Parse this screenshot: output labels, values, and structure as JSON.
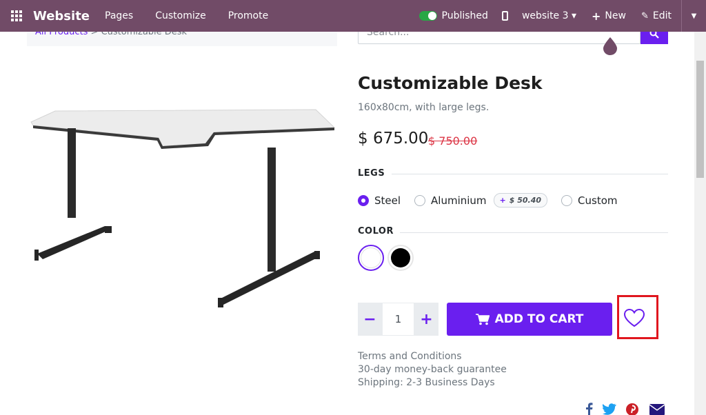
{
  "topbar": {
    "brand": "Website",
    "menus": [
      "Pages",
      "Customize",
      "Promote"
    ],
    "published_label": "Published",
    "website_selector": "website 3",
    "new_label": "New",
    "edit_label": "Edit"
  },
  "breadcrumb": {
    "parent": "All Products",
    "separator": ">",
    "current": "Customizable Desk"
  },
  "search": {
    "placeholder": "Search..."
  },
  "product": {
    "name": "Customizable Desk",
    "description": "160x80cm, with large legs.",
    "price": "$ 675.00",
    "old_price": "$ 750.00"
  },
  "attributes": {
    "legs": {
      "label": "LEGS",
      "options": [
        "Steel",
        "Aluminium",
        "Custom"
      ],
      "selected": "Steel",
      "aluminium_extra_sign": "+",
      "aluminium_extra": "$ 50.40"
    },
    "color": {
      "label": "COLOR",
      "swatches": [
        "#ffffff",
        "#000000"
      ],
      "selected": "#ffffff"
    }
  },
  "cart": {
    "quantity": "1",
    "minus": "−",
    "plus": "+",
    "add_label": "ADD TO CART"
  },
  "info": {
    "terms": "Terms and Conditions",
    "guarantee": "30-day money-back guarantee",
    "shipping": "Shipping: 2-3 Business Days"
  },
  "colors": {
    "topbar": "#714b67",
    "accent": "#6a1fef",
    "old_price": "#dc3545",
    "highlight": "#e0161e"
  }
}
